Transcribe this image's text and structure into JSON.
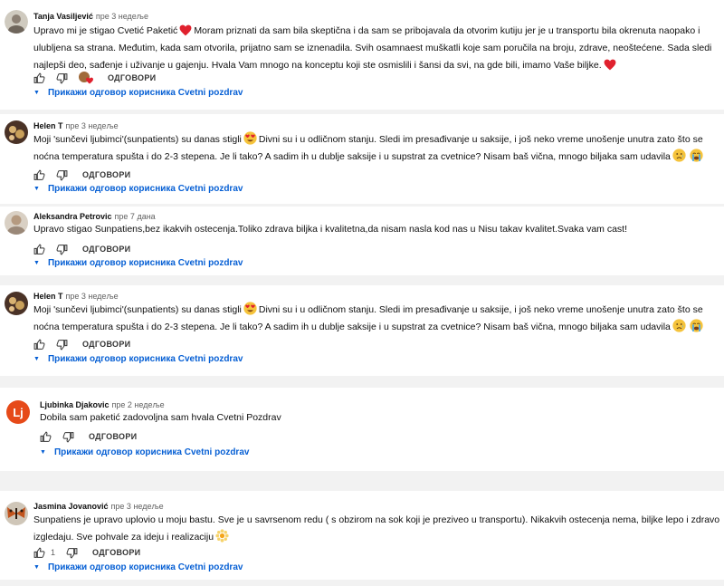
{
  "reply_label": "ОДГОВОРИ",
  "show_replies_label": "Прикажи одговор корисника Cvetni pozdrav",
  "comments": [
    {
      "author": "Tanja Vasiljević",
      "time": "пре 3 недеље",
      "segments": [
        "Upravo mi je stigao Cvetić Paketić",
        "Moram priznati da sam bila skeptična i da sam se pribojavala da otvorim kutiju jer je u transportu bila okrenuta naopako i ulubljena sa strana. Međutim, kada sam otvorila, prijatno sam se iznenadila. Svih osamnaest muškatli koje sam poručila na broju, zdrave, neoštećene. Sada sledi najlepši deo, sađenje i uživanje u gajenju. Hvala Vam mnogo na konceptu koji ste osmislili i šansi da svi, na gde bili, imamo Vaše biljke."
      ]
    },
    {
      "author": "Helen T",
      "time": "пре 3 недеље",
      "segments": [
        "Moji 'sunčevi ljubimci'(sunpatients) su danas stigli",
        "Divni su i u odličnom stanju. Sledi im presađivanje u saksije, i  još neko vreme unošenje unutra zato što se noćna temperatura spušta i do 2-3 stepena. Je li tako? A sadim ih u dublje saksije i u supstrat za cvetnice? Nisam baš vična, mnogo biljaka sam udavila"
      ]
    },
    {
      "author": "Aleksandra Petrovic",
      "time": "пре 7 дана",
      "segments": [
        "Upravo stigao Sunpatiens,bez ikakvih ostecenja.Toliko zdrava biljka i kvalitetna,da nisam nasla kod nas u Nisu takav kvalitet.Svaka vam cast!"
      ]
    },
    {
      "author": "Helen T",
      "time": "пре 3 недеље",
      "segments": [
        "Moji 'sunčevi ljubimci'(sunpatients) su danas stigli",
        "Divni su i u odličnom stanju. Sledi im presađivanje u saksije, i  još neko vreme unošenje unutra zato što se noćna temperatura spušta i do 2-3 stepena. Je li tako? A sadim ih u dublje saksije i u supstrat za cvetnice? Nisam baš vična, mnogo biljaka sam udavila"
      ]
    },
    {
      "author": "Ljubinka Djakovic",
      "time": "пре 2 недеље",
      "avatar_letter": "Lj",
      "segments": [
        "Dobila sam paketić zadovoljna sam hvala Cvetni Pozdrav"
      ]
    },
    {
      "author": "Jasmina Jovanović",
      "time": "пре 3 недеље",
      "likes": "1",
      "segments": [
        "Sunpatiens je upravo uplovio u moju bastu. Sve je u savrsenom redu ( s obzirom na sok koji je preziveo u transportu). Nikakvih ostecenja nema, biljke lepo i zdravo izgledaju. Sve pohvale za ideju i realizaciju"
      ]
    }
  ]
}
